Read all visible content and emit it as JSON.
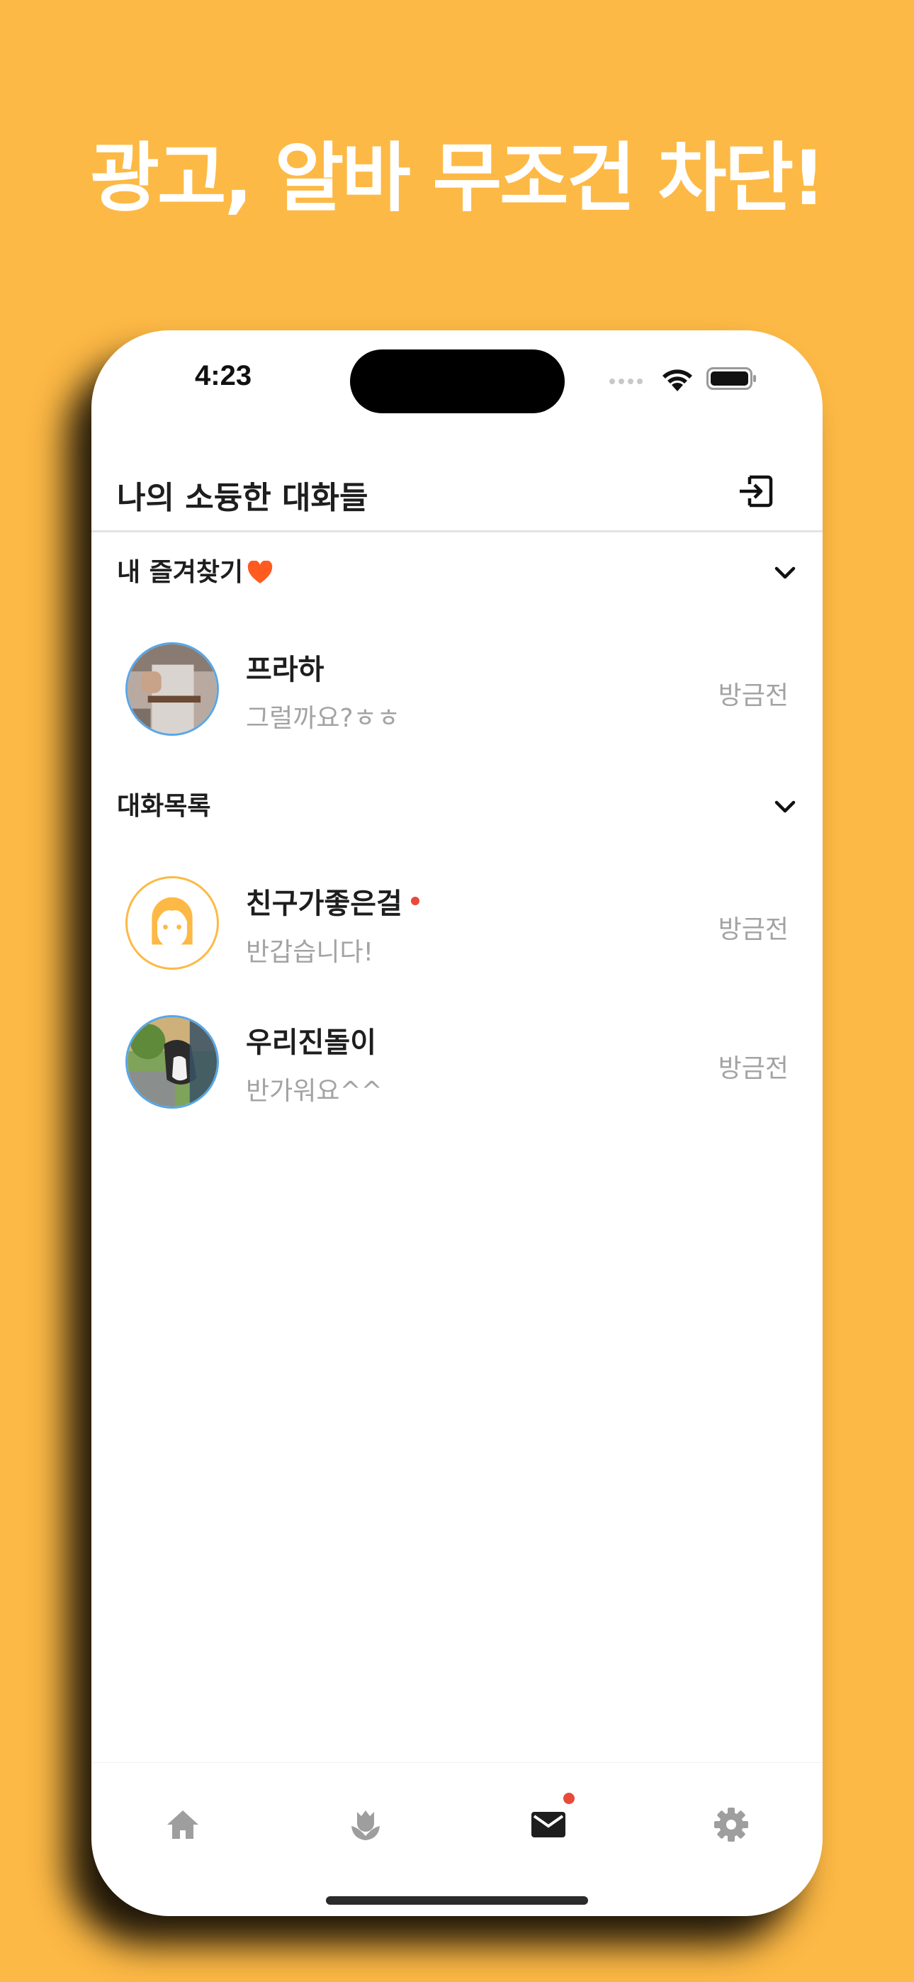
{
  "headline": "광고, 알바 무조건 차단!",
  "status_bar": {
    "time": "4:23"
  },
  "header": {
    "title": "나의 소듕한 대화들",
    "exit_icon": "exit-icon"
  },
  "favorites": {
    "title": "내 즐겨찾기",
    "items": [
      {
        "name": "프라하",
        "message": "그럴까요?ㅎㅎ",
        "time": "방금전",
        "unread": false
      }
    ]
  },
  "chats": {
    "title": "대화목록",
    "items": [
      {
        "name": "친구가좋은걸",
        "message": "반갑습니다!",
        "time": "방금전",
        "unread": true
      },
      {
        "name": "우리진돌이",
        "message": "반가워요^^",
        "time": "방금전",
        "unread": false
      }
    ]
  },
  "tab_bar": {
    "tabs": [
      {
        "icon": "home-icon",
        "active": false
      },
      {
        "icon": "flower-icon",
        "active": false
      },
      {
        "icon": "mail-icon",
        "active": true,
        "badge": true
      },
      {
        "icon": "gear-icon",
        "active": false
      }
    ]
  },
  "colors": {
    "background": "#FDB945",
    "accent_red": "#e84a3b",
    "inactive_icon": "#9e9e9e",
    "active_icon": "#1e1e1e",
    "heart": "#FF5A1F"
  }
}
